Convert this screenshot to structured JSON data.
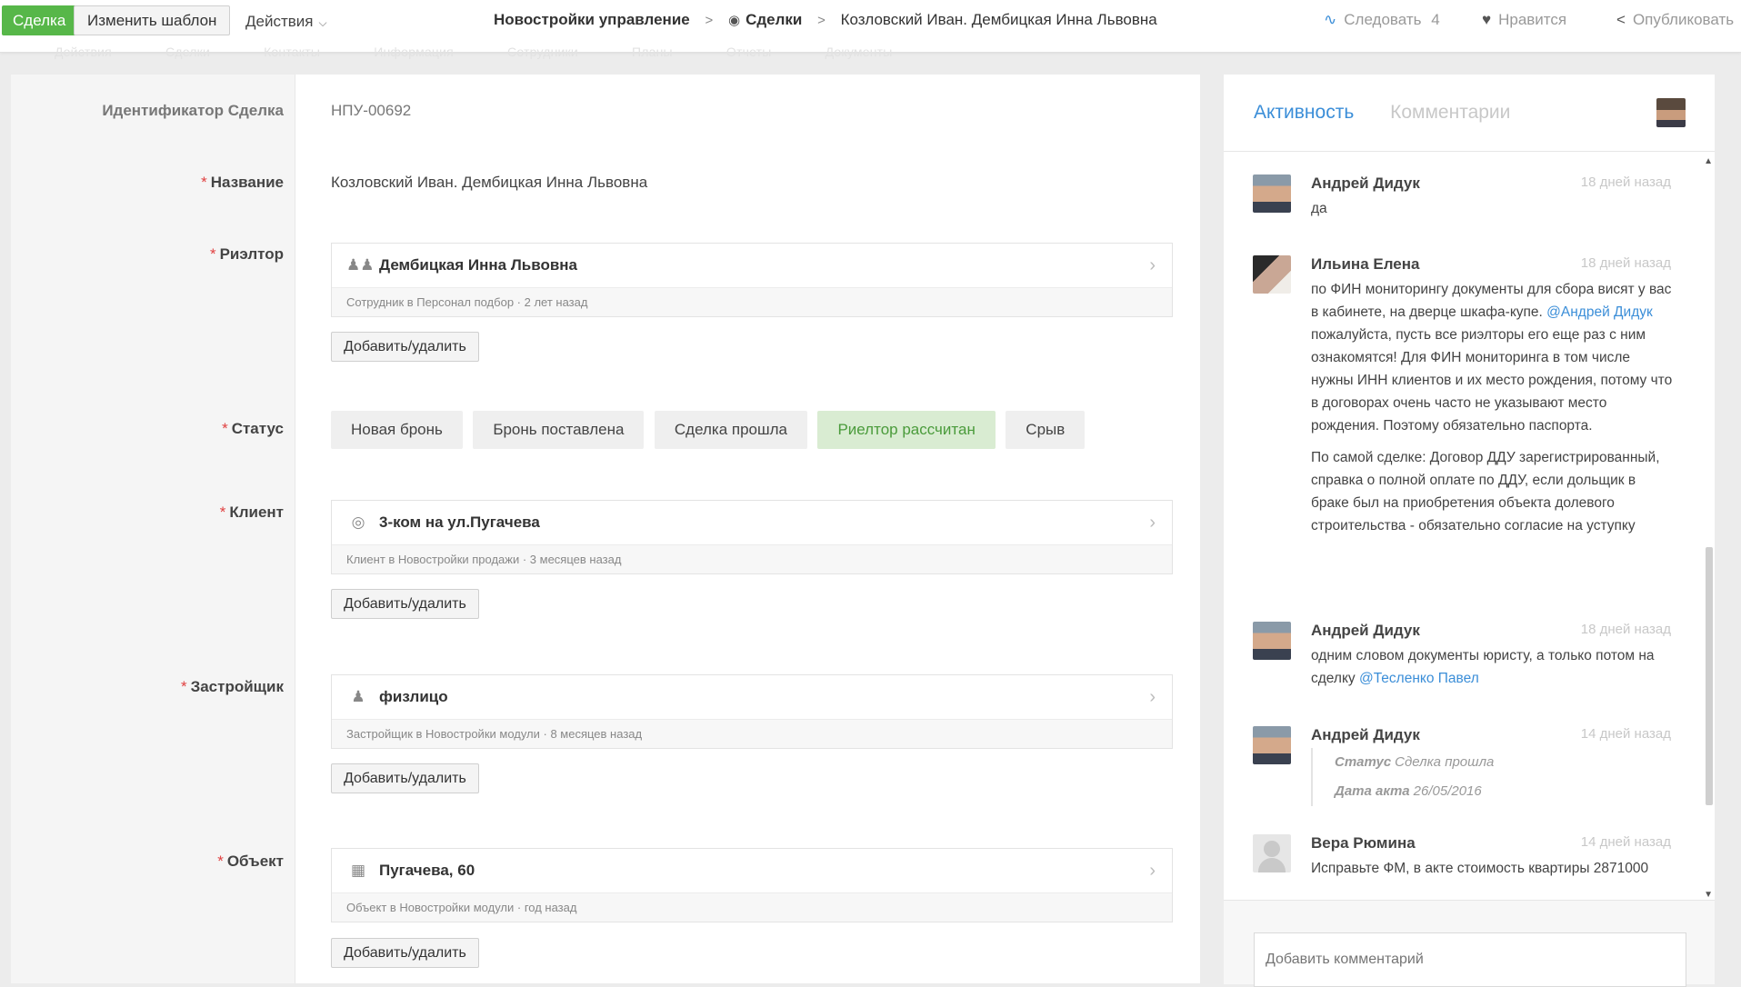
{
  "topbar": {
    "entity_label": "Сделка",
    "edit_template_label": "Изменить шаблон",
    "actions_label": "Действия",
    "breadcrumb": {
      "app": "Новостройки управление",
      "section": "Сделки",
      "record": "Козловский Иван. Дембицкая Инна Львовна"
    },
    "follow_label": "Следовать",
    "follow_count": "4",
    "like_label": "Нравится",
    "publish_label": "Опубликовать",
    "ghost_nav": [
      "Действия",
      "Сделки",
      "Контакты",
      "Информация",
      "Сотрудники",
      "Планы",
      "Отчеты",
      "Документы"
    ]
  },
  "form": {
    "id_label": "Идентификатор Сделка",
    "id_value": "НПУ-00692",
    "name_label": "Название",
    "name_value": "Козловский Иван. Дембицкая Инна Львовна",
    "realtor": {
      "label": "Риэлтор",
      "title": "Дембицкая Инна Львовна",
      "sub": "Сотрудник в Персонал подбор · 2 лет назад",
      "icon": "people-icon"
    },
    "add_remove_label": "Добавить/удалить",
    "status": {
      "label": "Статус",
      "options": [
        "Новая бронь",
        "Бронь поставлена",
        "Сделка прошла",
        "Риелтор рассчитан",
        "Срыв"
      ],
      "selected": "Риелтор рассчитан"
    },
    "client": {
      "label": "Клиент",
      "title": "3-ком на ул.Пугачева",
      "sub": "Клиент в Новостройки продажи · 3 месяцев назад",
      "icon": "money-icon"
    },
    "developer": {
      "label": "Застройщик",
      "title": "физлицо",
      "sub": "Застройщик в Новостройки модули · 8 месяцев назад",
      "icon": "person-icon"
    },
    "object": {
      "label": "Объект",
      "title": "Пугачева, 60",
      "sub": "Объект в Новостройки модули · год назад",
      "icon": "building-icon"
    }
  },
  "side": {
    "tab_activity": "Активность",
    "tab_comments": "Комментарии",
    "comment_placeholder": "Добавить комментарий",
    "entries": [
      {
        "name": "Андрей Дидук",
        "time": "18 дней назад",
        "text": "да"
      },
      {
        "name": "Ильина Елена",
        "time": "18 дней назад",
        "p1_before": "по ФИН мониторингу документы для сбора висят у вас в кабинете, на дверце шкафа-купе.",
        "p1_mention": "@Андрей Дидук",
        "p1_after": "пожалуйста, пусть все риэлторы его еще раз с ним ознакомятся! Для ФИН мониторинга в том числе нужны ИНН клиентов и их место рождения, потому что в договорах очень часто не указывают место рождения. Поэтому обязательно паспорта.",
        "p2": "По самой сделке: Договор ДДУ зарегистрированный, справка о полной оплате по ДДУ, если дольщик в браке был на приобретения объекта долевого строительства - обязательно согласие на уступку"
      },
      {
        "name": "Андрей Дидук",
        "time": "18 дней назад",
        "text_before": "одним словом документы юристу, а только потом на сделку",
        "mention": "@Тесленко Павел"
      },
      {
        "name": "Андрей Дидук",
        "time": "14 дней назад",
        "change1_key": "Статус",
        "change1_value": "Сделка прошла",
        "change2_key": "Дата акта",
        "change2_value": "26/05/2016"
      },
      {
        "name": "Вера Рюмина",
        "time": "14 дней назад",
        "text": "Исправьте ФМ, в акте стоимость квартиры 2871000"
      }
    ]
  }
}
